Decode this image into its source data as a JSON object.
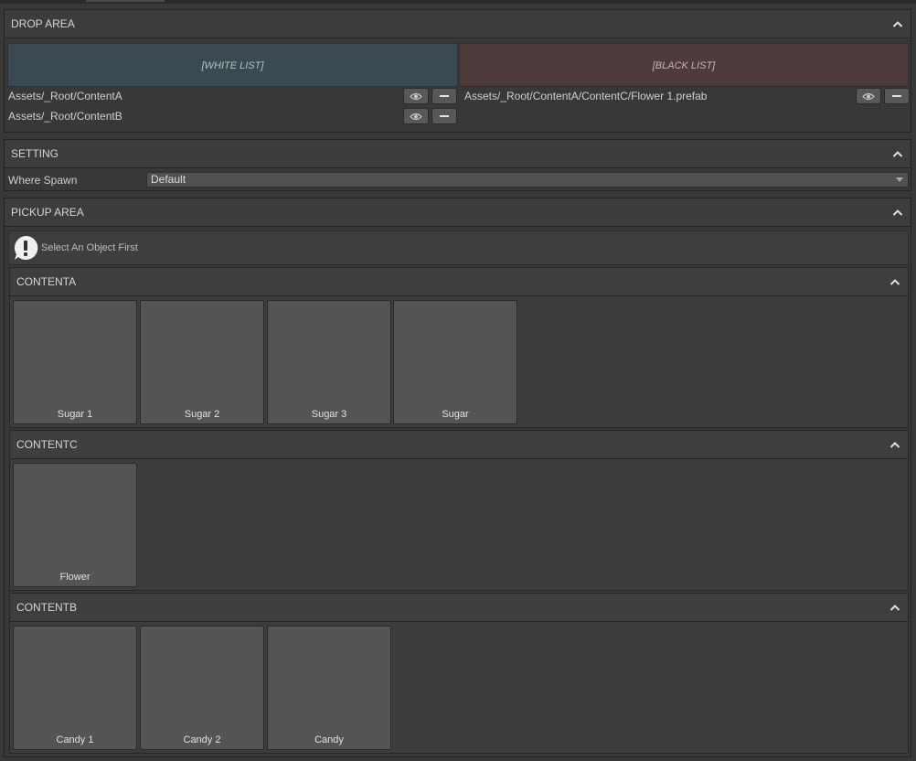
{
  "drop_area": {
    "title": "DROP AREA",
    "white_list_label": "[WHITE LIST]",
    "black_list_label": "[BLACK LIST]",
    "white_items": [
      "Assets/_Root/ContentA",
      "Assets/_Root/ContentB"
    ],
    "black_items": [
      "Assets/_Root/ContentA/ContentC/Flower 1.prefab"
    ]
  },
  "setting": {
    "title": "SETTING",
    "where_spawn_label": "Where Spawn",
    "where_spawn_value": "Default"
  },
  "pickup_area": {
    "title": "PICKUP AREA",
    "info": "Select An Object First",
    "groups": [
      {
        "title": "CONTENTA",
        "items": [
          "Sugar 1",
          "Sugar 2",
          "Sugar 3",
          "Sugar"
        ]
      },
      {
        "title": "CONTENTC",
        "items": [
          "Flower"
        ]
      },
      {
        "title": "CONTENTB",
        "items": [
          "Candy 1",
          "Candy 2",
          "Candy"
        ]
      }
    ]
  },
  "icons": [
    "chevron-up-icon",
    "eye-icon",
    "minus-icon",
    "warning-icon",
    "dropdown-arrow-icon"
  ]
}
